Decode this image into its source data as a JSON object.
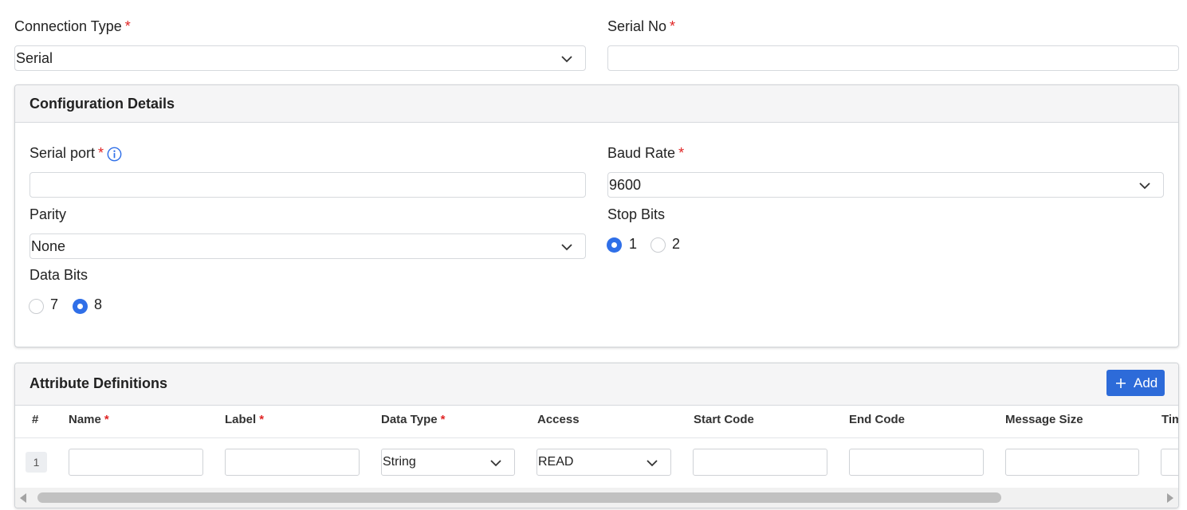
{
  "top": {
    "connection_type": {
      "label": "Connection Type",
      "required": "*",
      "value": "Serial"
    },
    "serial_no": {
      "label": "Serial No",
      "required": "*",
      "value": ""
    }
  },
  "config": {
    "title": "Configuration Details",
    "serial_port": {
      "label": "Serial port",
      "required": "*",
      "value": ""
    },
    "baud_rate": {
      "label": "Baud Rate",
      "required": "*",
      "value": "9600"
    },
    "parity": {
      "label": "Parity",
      "value": "None"
    },
    "stop_bits": {
      "label": "Stop Bits",
      "options": [
        "1",
        "2"
      ],
      "selected": "1"
    },
    "data_bits": {
      "label": "Data Bits",
      "options": [
        "7",
        "8"
      ],
      "selected": "8"
    }
  },
  "attributes": {
    "title": "Attribute Definitions",
    "add_label": "Add",
    "columns": [
      {
        "label": "#",
        "required": ""
      },
      {
        "label": "Name",
        "required": "*"
      },
      {
        "label": "Label",
        "required": "*"
      },
      {
        "label": "Data Type",
        "required": "*"
      },
      {
        "label": "Access",
        "required": ""
      },
      {
        "label": "Start Code",
        "required": ""
      },
      {
        "label": "End Code",
        "required": ""
      },
      {
        "label": "Message Size",
        "required": ""
      },
      {
        "label": "Tim",
        "required": ""
      }
    ],
    "rows": [
      {
        "index": "1",
        "name": "",
        "label": "",
        "data_type": "String",
        "access": "READ",
        "start_code": "",
        "end_code": "",
        "message_size": ""
      }
    ]
  },
  "colors": {
    "accent": "#2f6fe8",
    "button": "#2d6bd9",
    "required": "#e02424",
    "info": "#2f6fe8"
  }
}
